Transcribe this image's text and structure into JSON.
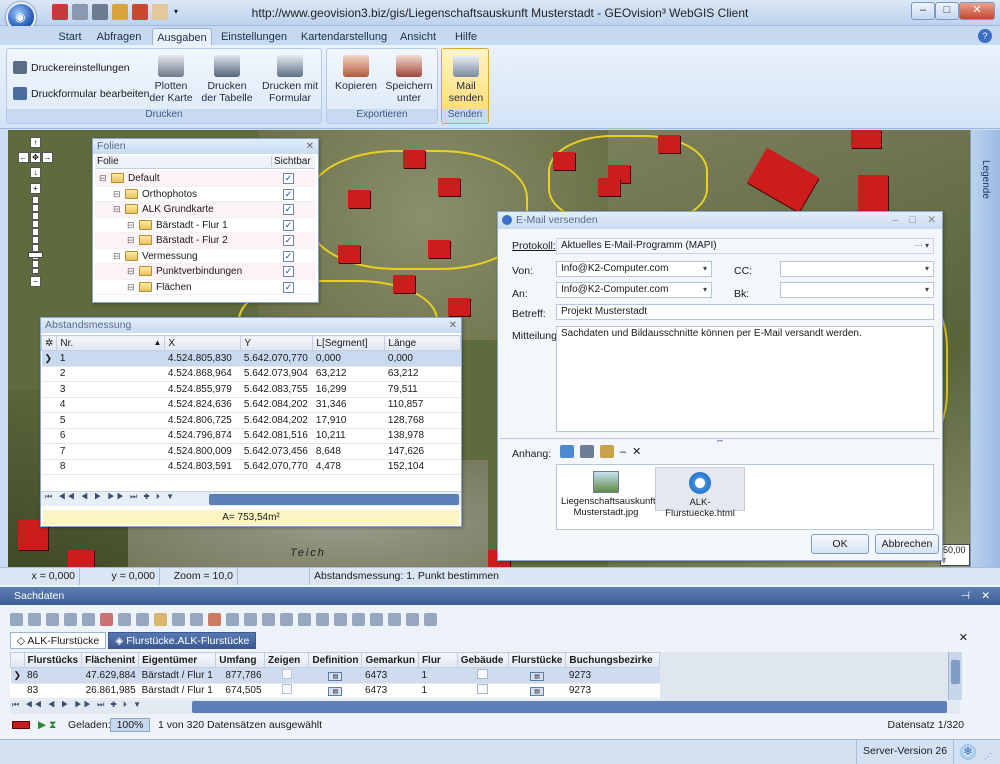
{
  "window": {
    "title": "http://www.geovision3.biz/gis/Liegenschaftsauskunft Musterstadt - GEOvision³ WebGIS Client"
  },
  "tabs": [
    "Start",
    "Abfragen",
    "Ausgaben",
    "Einstellungen",
    "Kartendarstellung",
    "Ansicht",
    "Hilfe"
  ],
  "ribbon": {
    "druckereinstellungen": "Druckereinstellungen",
    "druckformular": "Druckformular bearbeiten",
    "plotten": [
      "Plotten",
      "der Karte"
    ],
    "tabelle": [
      "Drucken",
      "der Tabelle"
    ],
    "formular": [
      "Drucken mit",
      "Formular"
    ],
    "kopieren": "Kopieren",
    "speichern": [
      "Speichern",
      "unter"
    ],
    "mail": [
      "Mail",
      "senden"
    ],
    "groups": {
      "drucken": "Drucken",
      "exportieren": "Exportieren",
      "senden": "Senden"
    }
  },
  "legend": {
    "label": "Legende"
  },
  "map": {
    "scale": "50,00 r",
    "labels": [
      "Teich"
    ]
  },
  "folien": {
    "title": "Folien",
    "col_folie": "Folie",
    "col_sichtbar": "Sichtbar",
    "items": [
      {
        "label": "Default",
        "indent": 0
      },
      {
        "label": "Orthophotos",
        "indent": 1
      },
      {
        "label": "ALK Grundkarte",
        "indent": 1
      },
      {
        "label": "Bärstadt - Flur 1",
        "indent": 2
      },
      {
        "label": "Bärstadt - Flur 2",
        "indent": 2
      },
      {
        "label": "Vermessung",
        "indent": 1
      },
      {
        "label": "Punktverbindungen",
        "indent": 2
      },
      {
        "label": "Flächen",
        "indent": 2
      }
    ]
  },
  "abstand": {
    "title": "Abstandsmessung",
    "headers": [
      "Nr.",
      "X",
      "Y",
      "L[Segment]",
      "Länge"
    ],
    "rows": [
      [
        "1",
        "4.524.805,830",
        "5.642.070,770",
        "0,000",
        "0,000"
      ],
      [
        "2",
        "4.524.868,964",
        "5.642.073,904",
        "63,212",
        "63,212"
      ],
      [
        "3",
        "4.524.855,979",
        "5.642.083,755",
        "16,299",
        "79,511"
      ],
      [
        "4",
        "4.524.824,636",
        "5.642.084,202",
        "31,346",
        "110,857"
      ],
      [
        "5",
        "4.524.806,725",
        "5.642.084,202",
        "17,910",
        "128,768"
      ],
      [
        "6",
        "4.524.796,874",
        "5.642.081,516",
        "10,211",
        "138,978"
      ],
      [
        "7",
        "4.524.800,009",
        "5.642.073,456",
        "8,648",
        "147,626"
      ],
      [
        "8",
        "4.524.803,591",
        "5.642.070,770",
        "4,478",
        "152,104"
      ]
    ],
    "area": "A= 753,54m²"
  },
  "email": {
    "title": "E-Mail versenden",
    "protokoll_label": "Protokoll:",
    "protokoll_value": "Aktuelles E-Mail-Programm (MAPI)",
    "von_label": "Von:",
    "von_value": "Info@K2-Computer.com",
    "cc_label": "CC:",
    "an_label": "An:",
    "an_value": "Info@K2-Computer.com",
    "bk_label": "Bk:",
    "betreff_label": "Betreff:",
    "betreff_value": "Projekt Musterstadt",
    "mitteilung_label": "Mitteilung:",
    "mitteilung_value": "Sachdaten und Bildausschnitte können per E-Mail versandt werden.",
    "anhang_label": "Anhang:",
    "attachments": [
      "Liegenschaftsauskunft Musterstadt.jpg",
      "ALK-Flurstuecke.html"
    ],
    "ok": "OK",
    "cancel": "Abbrechen"
  },
  "status": {
    "x": "x = 0,000",
    "y": "y = 0,000",
    "zoom": "Zoom = 10,0",
    "message": "Abstandsmessung: 1. Punkt bestimmen"
  },
  "sachdaten": {
    "title": "Sachdaten",
    "tabs": [
      "ALK-Flurstücke",
      "Flurstücke.ALK-Flurstücke"
    ],
    "headers": [
      "Flurstücks",
      "Flächenint",
      "Eigentümer",
      "Umfang",
      "Zeigen",
      "Definition",
      "Gemarkun",
      "Flur",
      "Gebäude",
      "Flurstücke",
      "Buchungsbezirke"
    ],
    "rows": [
      [
        "86",
        "47.629,884",
        "Bärstadt / Flur 1",
        "877,786",
        "",
        "",
        "6473",
        "1",
        "",
        "",
        "9273"
      ],
      [
        "83",
        "26.861,985",
        "Bärstadt / Flur 1",
        "674,505",
        "",
        "",
        "6473",
        "1",
        "",
        "",
        "9273"
      ]
    ],
    "geladen_label": "Geladen:",
    "percent": "100%",
    "selection": "1 von 320 Datensätzen ausgewählt",
    "record": "Datensatz 1/320"
  },
  "footer": {
    "version": "Server-Version 26"
  }
}
